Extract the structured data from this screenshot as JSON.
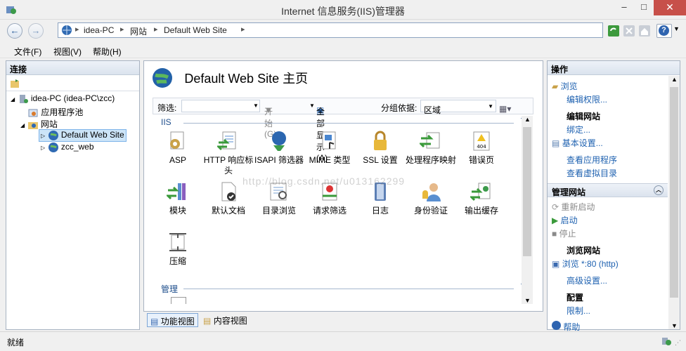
{
  "window": {
    "title": "Internet 信息服务(IIS)管理器",
    "minimize": "–",
    "maximize": "□",
    "close": "✕"
  },
  "address": {
    "crumbs": [
      "idea-PC",
      "网站",
      "Default Web Site"
    ],
    "sep": "▸",
    "help_icon": "?"
  },
  "menu": [
    "文件(F)",
    "视图(V)",
    "帮助(H)"
  ],
  "connections": {
    "title": "连接",
    "tree": [
      {
        "label": "idea-PC (idea-PC\\zcc)"
      },
      {
        "label": "应用程序池"
      },
      {
        "label": "网站"
      },
      {
        "label": "Default Web Site"
      },
      {
        "label": "zcc_web"
      }
    ]
  },
  "center": {
    "title": "Default Web Site 主页",
    "filter_label": "筛选:",
    "start_button": "开始(G)",
    "show_all_button": "全部显示(A)",
    "group_by_label": "分组依据:",
    "group_by_value": "区域",
    "groups": [
      "IIS",
      "管理"
    ],
    "features": [
      {
        "label": "ASP",
        "icon": "asp-icon"
      },
      {
        "label": "HTTP 响应标头",
        "icon": "http-headers-icon"
      },
      {
        "label": "ISAPI 筛选器",
        "icon": "isapi-filter-icon"
      },
      {
        "label": "MIME 类型",
        "icon": "mime-icon"
      },
      {
        "label": "SSL 设置",
        "icon": "ssl-lock-icon"
      },
      {
        "label": "处理程序映射",
        "icon": "handler-mapping-icon"
      },
      {
        "label": "错误页",
        "icon": "error-page-icon"
      },
      {
        "label": "模块",
        "icon": "modules-icon"
      },
      {
        "label": "默认文档",
        "icon": "default-document-icon"
      },
      {
        "label": "目录浏览",
        "icon": "directory-browsing-icon"
      },
      {
        "label": "请求筛选",
        "icon": "request-filtering-icon"
      },
      {
        "label": "日志",
        "icon": "logging-icon"
      },
      {
        "label": "身份验证",
        "icon": "authentication-icon"
      },
      {
        "label": "输出缓存",
        "icon": "output-cache-icon"
      },
      {
        "label": "压缩",
        "icon": "compression-icon"
      }
    ],
    "error_icon_text": "404",
    "tabs": [
      "功能视图",
      "内容视图"
    ]
  },
  "actions": {
    "title": "操作",
    "items": {
      "browse": "浏览",
      "edit_permissions": "编辑权限...",
      "edit_site": "编辑网站",
      "bindings": "绑定...",
      "basic_settings": "基本设置...",
      "view_apps": "查看应用程序",
      "view_vdirs": "查看虚拟目录",
      "manage_site": "管理网站",
      "restart": "重新启动",
      "start": "启动",
      "stop": "停止",
      "browse_site": "浏览网站",
      "browse_80": "浏览 *:80 (http)",
      "advanced": "高级设置...",
      "configure": "配置",
      "limits": "限制...",
      "help": "帮助"
    }
  },
  "status": {
    "text": "就绪"
  },
  "watermark": "http://blog.csdn.net/u013162299"
}
